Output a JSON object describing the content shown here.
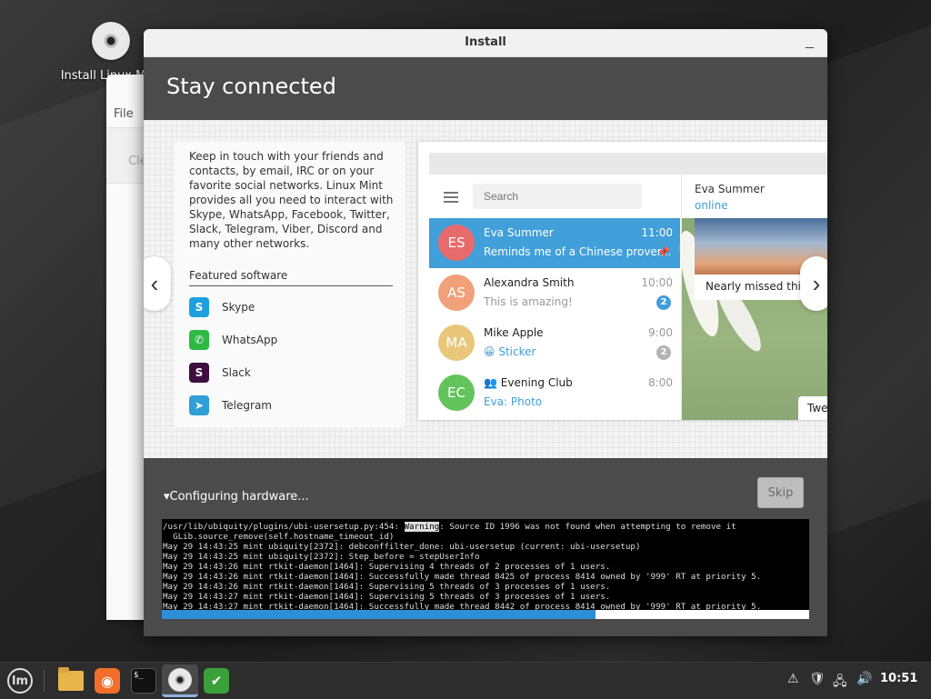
{
  "desktop": {
    "icon_label": "Install Linux Mint"
  },
  "back_window": {
    "menu_file": "File",
    "button_partial": "Cle"
  },
  "window": {
    "title": "Install",
    "minimize": "_"
  },
  "slide": {
    "heading": "Stay connected",
    "description": "Keep in touch with your friends and contacts, by email, IRC or on your favorite social networks. Linux Mint provides all you need to interact with Skype, WhatsApp, Facebook, Twitter, Slack, Telegram, Viber, Discord and many other networks.",
    "featured_label": "Featured software",
    "apps": [
      {
        "name": "Skype",
        "color": "#1ca0e0",
        "icon": "S"
      },
      {
        "name": "WhatsApp",
        "color": "#2fb844",
        "icon": "✆"
      },
      {
        "name": "Slack",
        "color": "#3f0e40",
        "icon": "S"
      },
      {
        "name": "Telegram",
        "color": "#2f9fd8",
        "icon": "➤"
      }
    ],
    "prev": "‹",
    "next": "›"
  },
  "telegram": {
    "search_placeholder": "Search",
    "chats": [
      {
        "initials": "ES",
        "name": "Eva Summer",
        "time": "11:00",
        "preview": "Reminds me of a Chinese prover...",
        "color": "#e86b6b",
        "badge": "📌"
      },
      {
        "initials": "AS",
        "name": "Alexandra Smith",
        "time": "10:00",
        "preview": "This is amazing!",
        "color": "#f0a17a",
        "badge": "2"
      },
      {
        "initials": "MA",
        "name": "Mike Apple",
        "time": "9:00",
        "preview": "😀 Sticker",
        "color": "#e8c77a",
        "badge": "2"
      },
      {
        "initials": "EC",
        "name": "Evening Club",
        "time": "8:00",
        "preview": "Eva: Photo",
        "color": "#62c45a",
        "badge": ""
      }
    ],
    "group_icon": "👥",
    "contact_name": "Eva Summer",
    "contact_status": "online",
    "message_text": "Nearly missed this s",
    "bubble_text": "Twe"
  },
  "progress": {
    "status": "Configuring hardware...",
    "toggle": "▾",
    "skip": "Skip",
    "fraction": 0.67,
    "log": [
      "/usr/lib/ubiquity/plugins/ubi-usersetup.py:454: ",
      "  GLib.source_remove(self.hostname_timeout_id)",
      "May 29 14:43:25 mint ubiquity[2372]: debconffilter_done: ubi-usersetup (current: ubi-usersetup)",
      "May 29 14:43:25 mint ubiquity[2372]: Step_before = stepUserInfo",
      "May 29 14:43:26 mint rtkit-daemon[1464]: Supervising 4 threads of 2 processes of 1 users.",
      "May 29 14:43:26 mint rtkit-daemon[1464]: Successfully made thread 8425 of process 8414 owned by '999' RT at priority 5.",
      "May 29 14:43:26 mint rtkit-daemon[1464]: Supervising 5 threads of 3 processes of 1 users.",
      "May 29 14:43:27 mint rtkit-daemon[1464]: Supervising 5 threads of 3 processes of 1 users.",
      "May 29 14:43:27 mint rtkit-daemon[1464]: Successfully made thread 8442 of process 8414 owned by '999' RT at priority 5."
    ],
    "log_warning_word": "Warning",
    "log_line1_rest": ": Source ID 1996 was not found when attempting to remove it"
  },
  "taskbar": {
    "menu": "lm",
    "terminal_prompt": "$_",
    "firefox_glyph": "◉",
    "shield_glyph": "✔",
    "tray": [
      "⚠",
      "🛡",
      "🖧",
      "🔊"
    ],
    "clock": "10:51"
  }
}
